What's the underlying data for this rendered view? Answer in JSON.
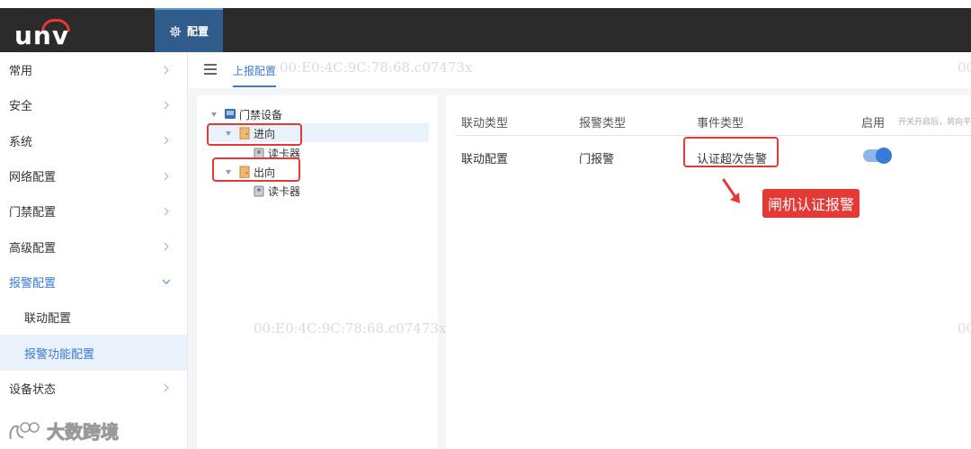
{
  "app": {
    "logo_text": "unv"
  },
  "topnav": {
    "tab_label": "配置",
    "icon": "gear-icon"
  },
  "sidebar": {
    "items": [
      {
        "label": "常用"
      },
      {
        "label": "安全"
      },
      {
        "label": "系统"
      },
      {
        "label": "网络配置"
      },
      {
        "label": "门禁配置"
      },
      {
        "label": "高级配置"
      },
      {
        "label": "报警配置",
        "expanded": true
      },
      {
        "label": "联动配置",
        "sub": true
      },
      {
        "label": "报警功能配置",
        "sub": true,
        "selected": true
      },
      {
        "label": "设备状态"
      }
    ]
  },
  "breadcrumb": {
    "current": "上报配置"
  },
  "tree": {
    "root": "门禁设备",
    "in": "进向",
    "in_reader": "读卡器",
    "out": "出向",
    "out_reader": "读卡器"
  },
  "table": {
    "headers": [
      "联动类型",
      "报警类型",
      "事件类型",
      "启用"
    ],
    "enable_note": "开关开启后，将向平",
    "rows": [
      {
        "linkage": "联动配置",
        "alarm": "门报警",
        "event": "认证超次告警",
        "enabled": true
      }
    ]
  },
  "annotation": {
    "callout": "闸机认证报警"
  },
  "watermarks": {
    "mac": "00:E0:4C:9C:78:68.c07473",
    "mac_short": "00:E0:4C:9C:78:68.c07473x",
    "edge": "00",
    "brand": "大数跨境"
  },
  "colors": {
    "accent": "#3a7bd5",
    "annotation_red": "#e53935",
    "topbar": "#2b2b2b"
  }
}
